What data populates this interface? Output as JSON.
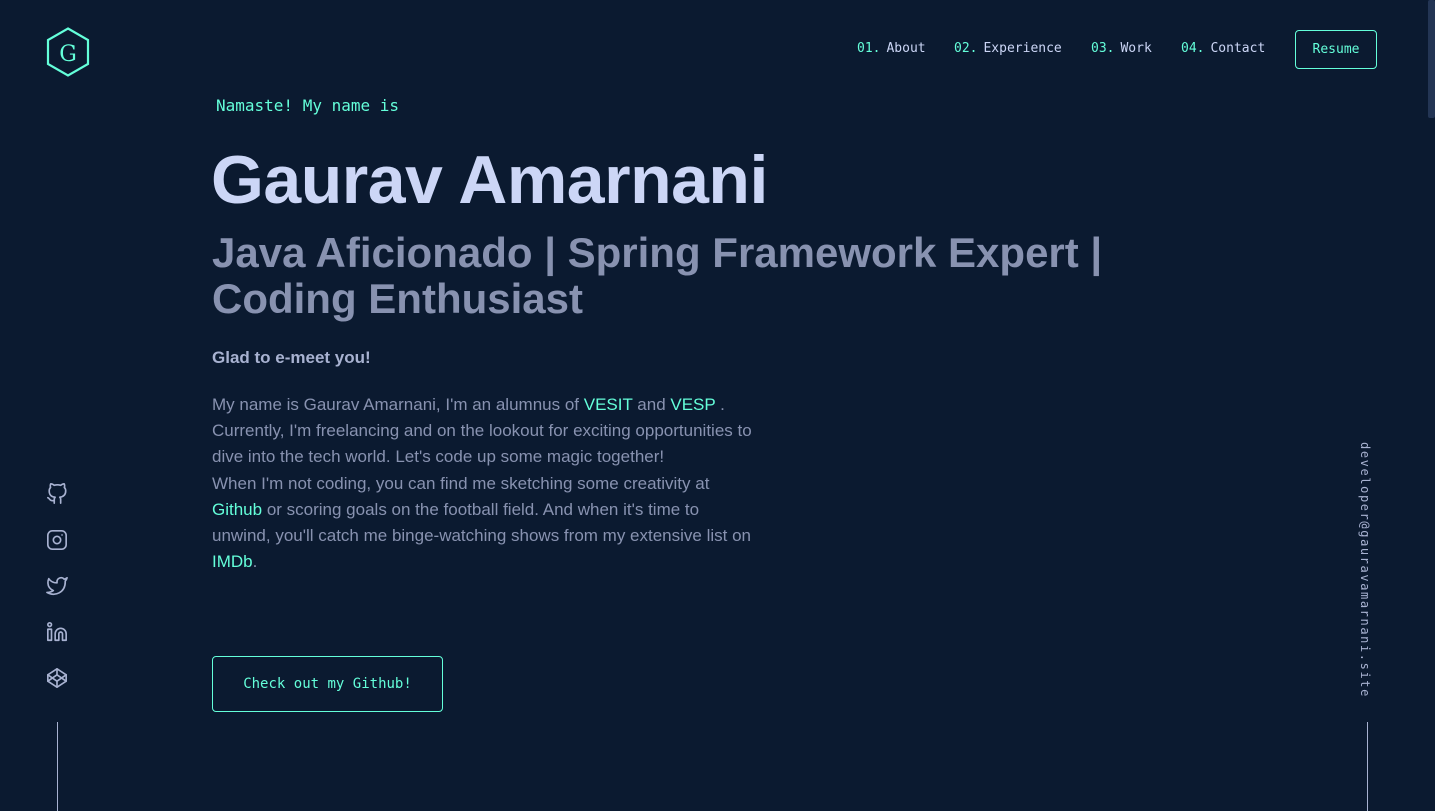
{
  "logo": {
    "letter": "G"
  },
  "nav": {
    "items": [
      {
        "num": "01.",
        "label": "About"
      },
      {
        "num": "02.",
        "label": "Experience"
      },
      {
        "num": "03.",
        "label": "Work"
      },
      {
        "num": "04.",
        "label": "Contact"
      }
    ],
    "resume_label": "Resume"
  },
  "hero": {
    "greeting": "Namaste! My name is",
    "name": "Gaurav Amarnani",
    "tagline": "Java Aficionado | Spring Framework Expert | Coding Enthusiast",
    "glad": "Glad to e-meet you!",
    "bio": {
      "p1_a": "My name is Gaurav Amarnani, I'm an alumnus of ",
      "link_vesit": "VESIT",
      "p1_b": " and ",
      "link_vesp": "VESP",
      "p1_c": " . Currently, I'm freelancing and on the lookout for exciting opportunities to dive into the tech world. Let's code up some magic together!",
      "p2_a": "When I'm not coding, you can find me sketching some creativity at ",
      "link_github": "Github",
      "p2_b": " or scoring goals on the football field. And when it's time to unwind, you'll catch me binge-watching shows from my extensive list on ",
      "link_imdb": "IMDb",
      "p2_c": "."
    },
    "cta_label": "Check out my Github!"
  },
  "social": [
    "github-icon",
    "instagram-icon",
    "twitter-icon",
    "linkedin-icon",
    "codepen-icon"
  ],
  "email": "developer@gauravamarnani.site",
  "colors": {
    "background": "#0b1a30",
    "accent": "#64ffda",
    "heading": "#ccd6f6",
    "text": "#8892b0"
  }
}
